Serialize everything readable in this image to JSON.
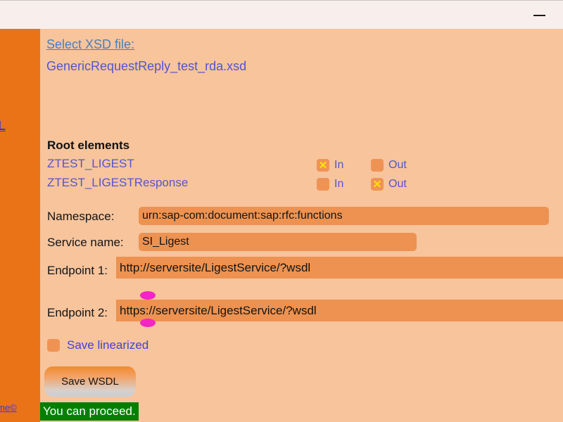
{
  "window": {
    "minimize_icon": "minimize-icon"
  },
  "sidebar": {
    "link_top_truncated": "L",
    "link_bottom_truncated": "lame©",
    "color": "#ea7317"
  },
  "main": {
    "background_color": "#f7c49c",
    "select_xsd_label": "Select XSD file:",
    "xsd_file_name": "GenericRequestReply_test_rda.xsd",
    "root_elements_heading": "Root elements",
    "root_elements": [
      {
        "name": "ZTEST_LIGEST",
        "in_label": "In",
        "in_checked": true,
        "out_label": "Out",
        "out_checked": false
      },
      {
        "name": "ZTEST_LIGESTResponse",
        "in_label": "In",
        "in_checked": false,
        "out_label": "Out",
        "out_checked": true
      }
    ],
    "checkbox_check_glyph": "✕",
    "fields": {
      "namespace_label": "Namespace:",
      "namespace_value": "urn:sap-com:document:sap:rfc:functions",
      "service_name_label": "Service name:",
      "service_name_value": "SI_Ligest",
      "endpoint1_label": "Endpoint 1:",
      "endpoint1_value": "http://serversite/LigestService/?wsdl",
      "endpoint2_label": "Endpoint 2:",
      "endpoint2_value": "https://serversite/LigestService/?wsdl"
    },
    "save_linearized_label": "Save linearized",
    "save_linearized_checked": false,
    "save_button_label": "Save WSDL",
    "status_message": "You can proceed.",
    "status_color": "#008000",
    "input_color": "#ed9250",
    "handle_color": "#f226c2"
  }
}
